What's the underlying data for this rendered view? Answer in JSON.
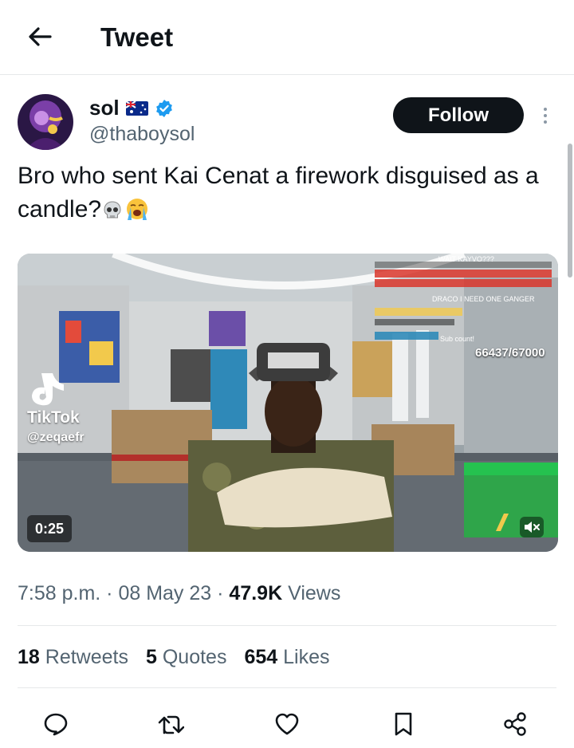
{
  "topbar": {
    "title": "Tweet",
    "back_icon": "arrow-left-icon"
  },
  "author": {
    "display_name": "sol",
    "handle": "@thaboysol",
    "flag_icon": "australia-flag-icon",
    "verified_icon": "verified-badge-icon",
    "follow_label": "Follow"
  },
  "tweet": {
    "text": "Bro who sent Kai Cenat a firework disguised as a candle?",
    "emojis": [
      "skull-emoji",
      "loudly-crying-face-emoji"
    ]
  },
  "media": {
    "tiktok_label": "TikTok",
    "tiktok_user": "@zeqaefr",
    "sub_count": "66437/67000",
    "chat_wait": "WAIT KAYVO???",
    "chat_draco": "DRACO I NEED ONE GANGER",
    "chat_sub": "Sub count!",
    "duration": "0:25",
    "mute_icon": "volume-muted-icon"
  },
  "meta": {
    "time": "7:58 p.m.",
    "sep": " · ",
    "date": "08 May 23",
    "views_count": "47.9K",
    "views_label": "Views"
  },
  "stats": {
    "retweets_count": "18",
    "retweets_label": "Retweets",
    "quotes_count": "5",
    "quotes_label": "Quotes",
    "likes_count": "654",
    "likes_label": "Likes"
  },
  "colors": {
    "text": "#0f1419",
    "secondary": "#536471",
    "verified": "#1d9bf0",
    "divider": "#e6e8ea"
  },
  "actions": [
    "reply-icon",
    "retweet-icon",
    "like-icon",
    "bookmark-icon",
    "share-icon"
  ]
}
